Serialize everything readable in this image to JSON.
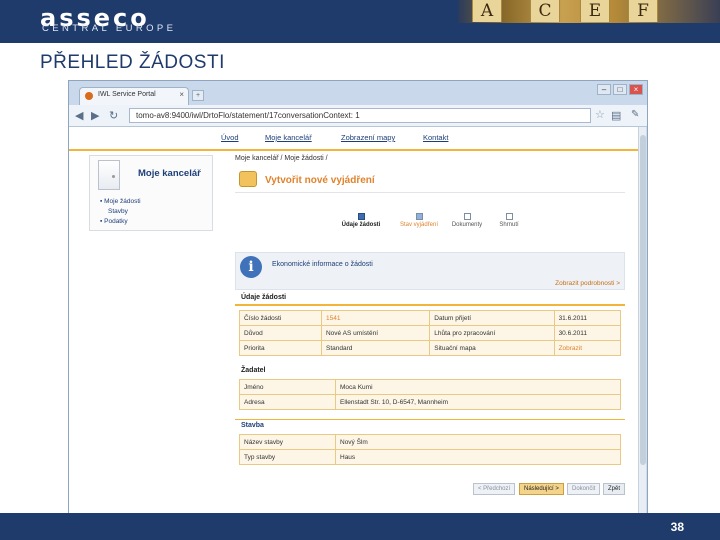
{
  "slide": {
    "logo_word": "asseco",
    "logo_sub": "CENTRAL EUROPE",
    "header_keys": [
      "A",
      "C",
      "E",
      "F"
    ],
    "title": "PŘEHLED ŽÁDOSTI",
    "page_number": "38",
    "header_color": "#1f3b6b"
  },
  "browser": {
    "tab_title": "IWL Service Portal",
    "tab_close": "×",
    "new_tab": "+",
    "url": "tomo-av8:9400/iwl/DrtoFlo/statement/17conversationContext: 1",
    "window_controls": [
      "–",
      "□",
      "×"
    ]
  },
  "menu": {
    "items": [
      "Úvod",
      "Moje kancelář",
      "Zobrazení mapy",
      "Kontakt"
    ]
  },
  "sidebar": {
    "title": "Moje kancelář",
    "links": [
      "Moje žádosti",
      "Stavby",
      "Podatky"
    ]
  },
  "content": {
    "breadcrumb": "Moje kancelář / Moje žádosti /",
    "page_title": "Vytvořit nové vyjádření",
    "steps": [
      {
        "label": "Údaje žádosti",
        "state": "active"
      },
      {
        "label": "Stav vyjádření",
        "state": "done"
      },
      {
        "label": "Dokumenty",
        "state": "todo"
      },
      {
        "label": "Shrnutí",
        "state": "todo"
      }
    ],
    "info_text": "Ekonomické informace o žádosti",
    "info_link": "Zobrazit podrobnosti >",
    "request_section": "Údaje žádosti",
    "request_rows": [
      {
        "l1": "Číslo žádosti",
        "v1": "1541",
        "l2": "Datum přijetí",
        "v2": "31.6.2011"
      },
      {
        "l1": "Důvod",
        "v1": "Nové AS umístění",
        "l2": "Lhůta pro zpracování",
        "v2": "30.6.2011"
      },
      {
        "l1": "Priorita",
        "v1": "Standard",
        "l2": "Situační mapa",
        "v2": "Zobrazit"
      }
    ],
    "applicant_section": "Žadatel",
    "applicant_rows": [
      {
        "label": "Jméno",
        "value": "Moca Kumi"
      },
      {
        "label": "Adresa",
        "value": "Ellenstadt Str. 10, D-6547, Mannheim"
      }
    ],
    "building_section": "Stavba",
    "building_rows": [
      {
        "label": "Název stavby",
        "value": "Nový Šlm"
      },
      {
        "label": "Typ stavby",
        "value": "Haus"
      }
    ],
    "buttons": {
      "previous": "< Předchozí",
      "next": "Následující >",
      "finish": "Dokončit",
      "back": "Zpět"
    }
  }
}
